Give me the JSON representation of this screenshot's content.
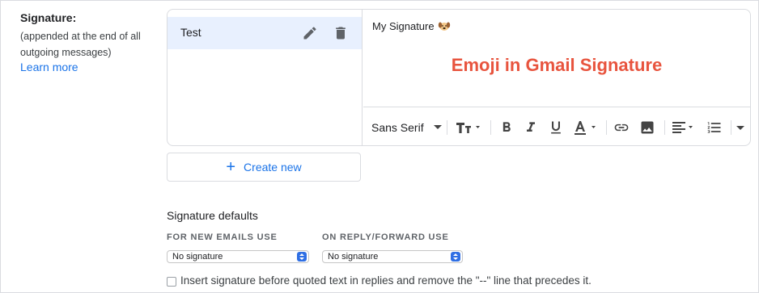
{
  "signature_section": {
    "label": "Signature:",
    "description": "(appended at the end of all outgoing messages)",
    "learn_more": "Learn more"
  },
  "signatures": [
    {
      "name": "Test",
      "icons": [
        "edit-icon",
        "delete-icon"
      ]
    }
  ],
  "editor": {
    "content": "My Signature",
    "emoji_icon": "dog-face-icon",
    "overlay_title": "Emoji in Gmail Signature"
  },
  "toolbar": {
    "font": "Sans Serif",
    "icons": [
      "font-size-icon",
      "bold-icon",
      "italic-icon",
      "underline-icon",
      "text-color-icon",
      "link-icon",
      "image-icon",
      "align-icon",
      "numbered-list-icon",
      "more-options-icon"
    ]
  },
  "create_new": "Create new",
  "defaults": {
    "title": "Signature defaults",
    "new_emails_label": "FOR NEW EMAILS USE",
    "new_emails_value": "No signature",
    "reply_label": "ON REPLY/FORWARD USE",
    "reply_value": "No signature"
  },
  "insert_option": {
    "checked": false,
    "label": "Insert signature before quoted text in replies and remove the \"--\" line that precedes it."
  },
  "colors": {
    "link": "#1a73e8",
    "selected_row": "#e8f0fe",
    "overlay_title": "#e8543e",
    "stepper": "#2f6fe4"
  }
}
